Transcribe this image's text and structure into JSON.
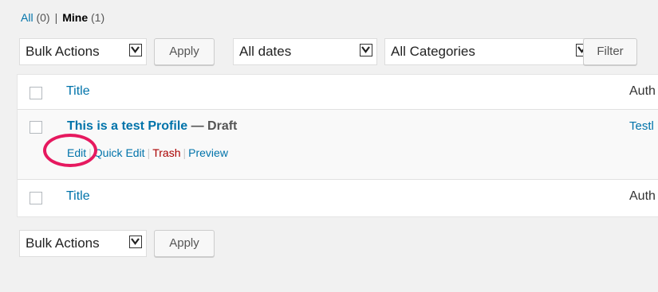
{
  "filters": {
    "all_label": "All",
    "all_count": "(0)",
    "separator": "|",
    "mine_label": "Mine",
    "mine_count": "(1)"
  },
  "top_nav": {
    "bulk_actions": "Bulk Actions",
    "apply": "Apply",
    "dates": "All dates",
    "categories": "All Categories",
    "filter": "Filter"
  },
  "table": {
    "header": {
      "title": "Title",
      "author": "Auth"
    },
    "rows": [
      {
        "title": "This is a test Profile",
        "state_sep": " — ",
        "state": "Draft",
        "author": "Testl",
        "actions": {
          "edit": "Edit",
          "quick_edit": "Quick Edit",
          "trash": "Trash",
          "preview": "Preview",
          "separator": "|"
        }
      }
    ],
    "footer": {
      "title": "Title",
      "author": "Auth"
    }
  },
  "bottom_nav": {
    "bulk_actions": "Bulk Actions",
    "apply": "Apply"
  },
  "colors": {
    "link": "#0073aa",
    "trash": "#aa0000",
    "highlight_ring": "#e6195f",
    "background": "#f1f1f1"
  }
}
